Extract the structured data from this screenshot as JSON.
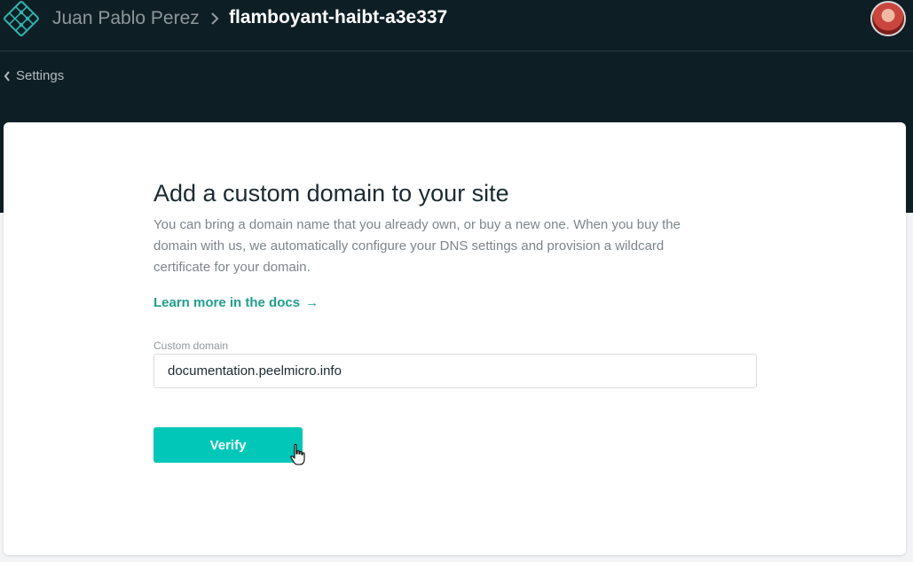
{
  "header": {
    "owner_name": "Juan Pablo Perez",
    "site_name": "flamboyant-haibt-a3e337",
    "logo_icon": "netlify-logo-icon",
    "separator_icon": "chevron-right-icon",
    "avatar_icon": "user-avatar"
  },
  "nav": {
    "back_label": "Settings",
    "back_icon": "chevron-left-icon"
  },
  "main": {
    "title": "Add a custom domain to your site",
    "description": "You can bring a domain name that you already own, or buy a new one. When you buy the domain with us, we automatically configure your DNS settings and provision a wildcard certificate for your domain.",
    "docs_link_label": "Learn more in the docs",
    "docs_link_arrow": "→",
    "field": {
      "label": "Custom domain",
      "value": "documentation.peelmicro.info"
    },
    "verify_label": "Verify"
  },
  "colors": {
    "header_bg": "#0e1e25",
    "accent_teal": "#00c7b7",
    "link_teal": "#1f9e8d",
    "title_text": "#1b2a31",
    "muted_text": "#7d858a"
  }
}
